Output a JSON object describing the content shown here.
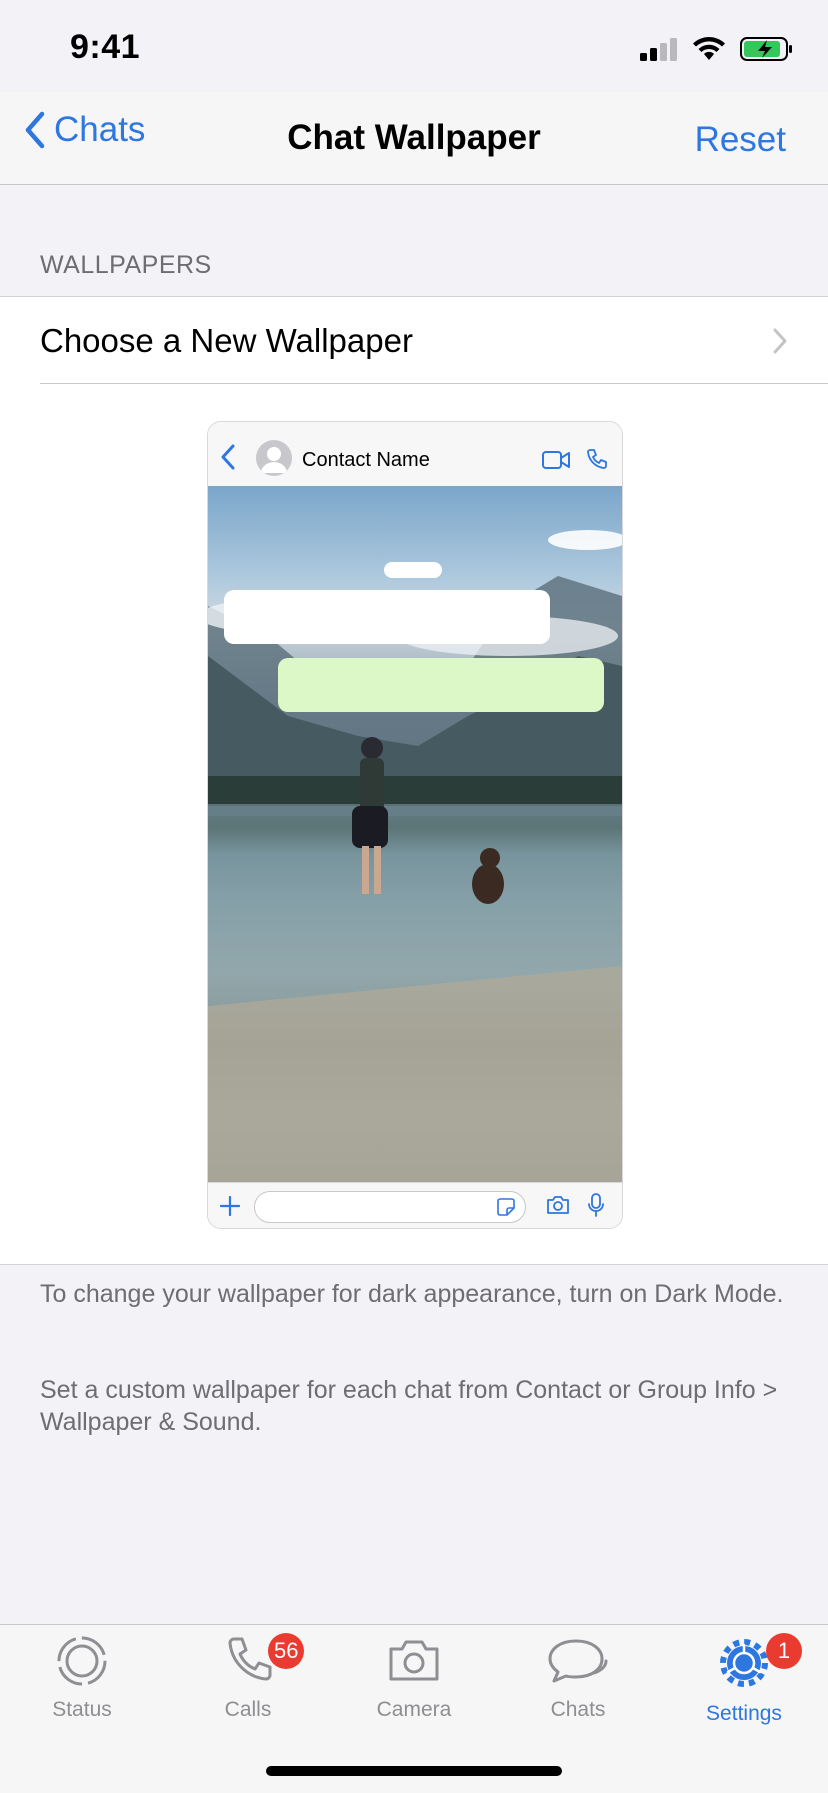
{
  "status_bar": {
    "time": "9:41"
  },
  "nav": {
    "back_label": "Chats",
    "title": "Chat Wallpaper",
    "reset_label": "Reset"
  },
  "section": {
    "header": "WALLPAPERS",
    "choose_label": "Choose a New Wallpaper"
  },
  "preview": {
    "contact_name": "Contact Name"
  },
  "footnotes": {
    "dark_mode": "To change your wallpaper for dark appearance, turn on Dark Mode.",
    "custom": "Set a custom wallpaper for each chat from Contact or Group Info > Wallpaper & Sound."
  },
  "tabs": [
    {
      "label": "Status",
      "icon": "status-icon"
    },
    {
      "label": "Calls",
      "icon": "phone-icon",
      "badge": "56"
    },
    {
      "label": "Camera",
      "icon": "camera-icon"
    },
    {
      "label": "Chats",
      "icon": "chat-bubbles-icon"
    },
    {
      "label": "Settings",
      "icon": "gear-icon",
      "badge": "1",
      "active": true
    }
  ],
  "colors": {
    "accent": "#2e76e0",
    "badge": "#ea3b30",
    "outgoing_bubble": "#dcf8c6"
  }
}
